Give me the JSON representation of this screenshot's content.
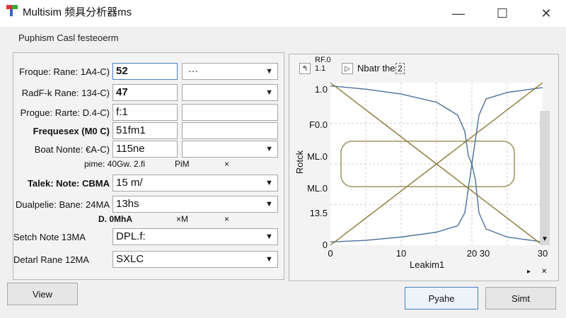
{
  "window": {
    "title": "Multisim 频具分析器ms"
  },
  "tool_label": "Puphism Casl festeoerm",
  "rows": [
    {
      "label": "Froque: Rane: 1A4-C)",
      "value": "52",
      "dd_text": "···"
    },
    {
      "label": "RadF-k Rane: 134-C)",
      "value": "47",
      "dd_text": ""
    },
    {
      "label": "Progue: Rarte: D.4-C)",
      "value": "f:1",
      "dd_text": ""
    },
    {
      "label": "Frequesex (M0 C)",
      "value": "51fm1",
      "dd_text": ""
    },
    {
      "label": "Boat Nonte: €A-C)",
      "value": "115ne",
      "dd_text": ""
    },
    {
      "label": "Talek: Note: CBMA",
      "value": "15 m/",
      "dd_text": ""
    },
    {
      "label": "Dualpelie: Bane: 24MA",
      "value": "13hs",
      "dd_text": ""
    },
    {
      "label": "Setch Note    13MA",
      "value": "DPL.f:",
      "dd_text": ""
    },
    {
      "label": "Detarl Rane  12MA",
      "value": "SXLC",
      "dd_text": ""
    }
  ],
  "sublines": [
    {
      "a": "pime: 40Gw. 2.fi",
      "b": "PiM",
      "c": "×"
    },
    {
      "a": "D.  0MhA",
      "b": "×M",
      "c": "×"
    }
  ],
  "chart": {
    "title": "Nbatr the",
    "badge": "2",
    "corner_label": "RF.0 1.1",
    "ylabel": "Rotck",
    "xlabel": "Leakim1",
    "yticks": [
      "0",
      "13.5",
      "ML.0",
      "ML.0",
      "F0.0",
      "1.0"
    ],
    "xticks": [
      "0",
      "10",
      "20",
      "30",
      "30"
    ]
  },
  "chart_data": {
    "type": "line",
    "xlim": [
      0,
      30
    ],
    "ylim": [
      0,
      1
    ],
    "series": [
      {
        "values_x": [
          0,
          5,
          10,
          15,
          18,
          19,
          19.5,
          20,
          20.5,
          21,
          22,
          25,
          30
        ],
        "values_y": [
          0.02,
          0.03,
          0.05,
          0.08,
          0.12,
          0.2,
          0.35,
          0.5,
          0.65,
          0.8,
          0.9,
          0.94,
          0.97
        ]
      },
      {
        "values_x": [
          0,
          5,
          10,
          15,
          18,
          19,
          19.5,
          20,
          20.5,
          21,
          22,
          25,
          30
        ],
        "values_y": [
          0.98,
          0.96,
          0.93,
          0.88,
          0.8,
          0.7,
          0.55,
          0.5,
          0.4,
          0.2,
          0.1,
          0.05,
          0.02
        ]
      },
      {
        "values_x": [
          0,
          30
        ],
        "values_y": [
          0,
          1
        ]
      },
      {
        "values_x": [
          0,
          30
        ],
        "values_y": [
          1,
          0
        ]
      }
    ]
  },
  "buttons": {
    "view": "View",
    "apply": "Pyahe",
    "simt": "Simt"
  }
}
